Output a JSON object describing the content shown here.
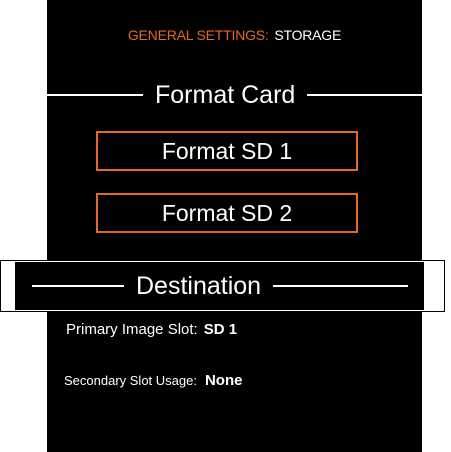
{
  "header": {
    "section": "GENERAL SETTINGS:",
    "page": "STORAGE"
  },
  "format_card": {
    "title": "Format Card",
    "buttons": [
      {
        "label": "Format SD 1"
      },
      {
        "label": "Format SD 2"
      }
    ]
  },
  "destination": {
    "title": "Destination",
    "primary": {
      "label": "Primary Image Slot:",
      "value": "SD 1"
    },
    "secondary": {
      "label": "Secondary Slot Usage:",
      "value": "None"
    }
  },
  "colors": {
    "accent": "#e2691e",
    "background": "#000000",
    "text": "#ffffff"
  }
}
